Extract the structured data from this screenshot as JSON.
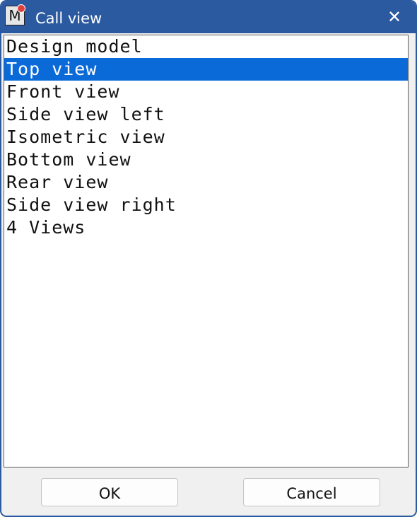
{
  "window": {
    "title": "Call view",
    "app_icon": "M",
    "close_icon": "✕"
  },
  "list": {
    "selected_index": 1,
    "items": [
      "Design model",
      "Top view",
      "Front view",
      "Side view left",
      "Isometric view",
      "Bottom view",
      "Rear view",
      "Side view right",
      "4 Views"
    ]
  },
  "buttons": {
    "ok": "OK",
    "cancel": "Cancel"
  }
}
